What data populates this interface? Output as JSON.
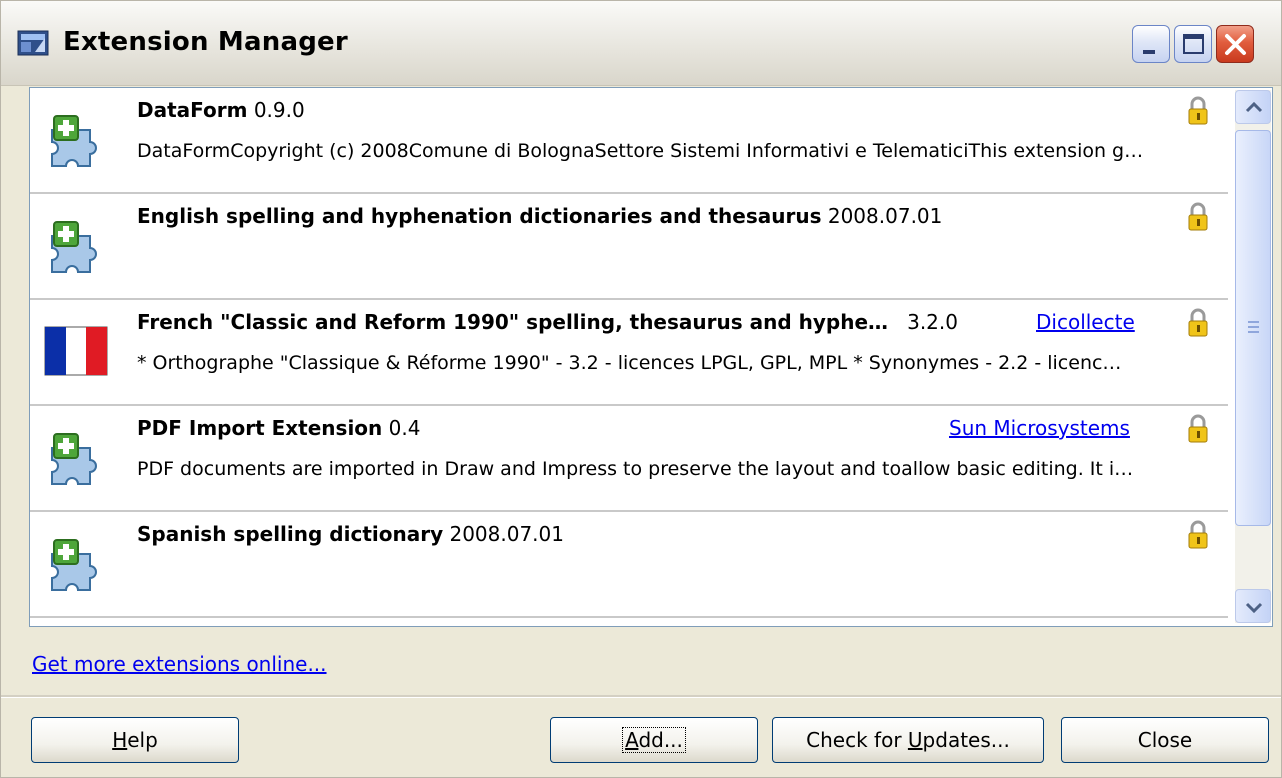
{
  "window": {
    "title": "Extension Manager",
    "accent_color": "#0054E3"
  },
  "extensions": [
    {
      "name": "DataForm",
      "version": "0.9.0",
      "publisher": "",
      "description": "DataFormCopyright (c) 2008Comune di BolognaSettore Sistemi Informativi e TelematiciThis extension g…",
      "icon": "puzzle-icon"
    },
    {
      "name": "English spelling and hyphenation dictionaries and thesaurus",
      "version": "2008.07.01",
      "publisher": "",
      "description": "",
      "icon": "puzzle-icon"
    },
    {
      "name": "French \"Classic and Reform 1990\" spelling, thesaurus and hyphe…",
      "version": "3.2.0",
      "publisher": "Dicollecte",
      "description": "* Orthographe \"Classique & Réforme 1990\" - 3.2 - licences LPGL, GPL, MPL  * Synonymes - 2.2 - licenc…",
      "icon": "french-flag-icon"
    },
    {
      "name": "PDF Import Extension",
      "version": "0.4",
      "publisher": "Sun Microsystems",
      "description": "PDF documents are imported in Draw and Impress to preserve the layout and toallow basic editing. It i…",
      "icon": "puzzle-icon"
    },
    {
      "name": "Spanish spelling dictionary",
      "version": "2008.07.01",
      "publisher": "",
      "description": "",
      "icon": "puzzle-icon"
    }
  ],
  "links": {
    "more_extensions": "Get more extensions online..."
  },
  "buttons": {
    "help_prefix": "",
    "help_mnemonic": "H",
    "help_rest": "elp",
    "add_prefix": "",
    "add_mnemonic": "A",
    "add_rest": "dd...",
    "updates_prefix": "Check for ",
    "updates_mnemonic": "U",
    "updates_rest": "pdates...",
    "close": "Close"
  }
}
